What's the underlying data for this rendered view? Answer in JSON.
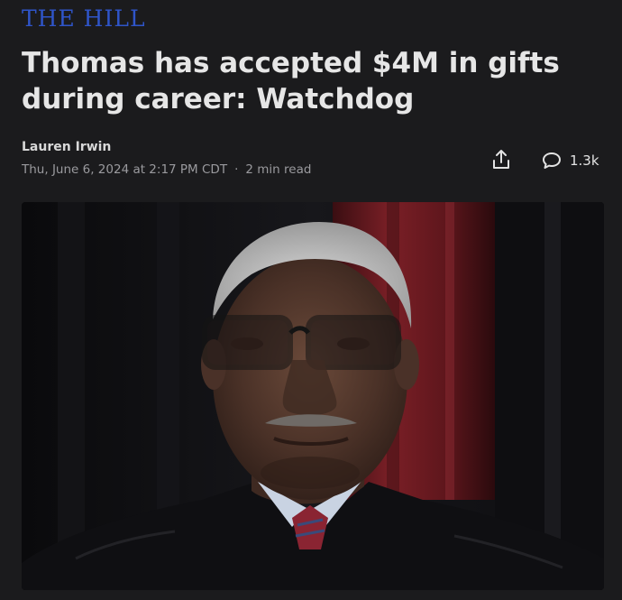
{
  "publisher": {
    "name": "THE HILL"
  },
  "article": {
    "headline": "Thomas has accepted $4M in gifts during career: Watchdog",
    "author": "Lauren Irwin",
    "date": "Thu, June 6, 2024 at 2:17 PM CDT",
    "separator": "·",
    "read_time": "2 min read"
  },
  "actions": {
    "share_icon": "share-icon",
    "comment_icon": "comment-bubble-icon",
    "comment_count": "1.3k"
  },
  "colors": {
    "background": "#1b1b1d",
    "publisher_blue": "#2f55c9",
    "headline": "#e6e6e6",
    "meta": "#9a9a9e",
    "curtain_red": "#7a1f26"
  }
}
